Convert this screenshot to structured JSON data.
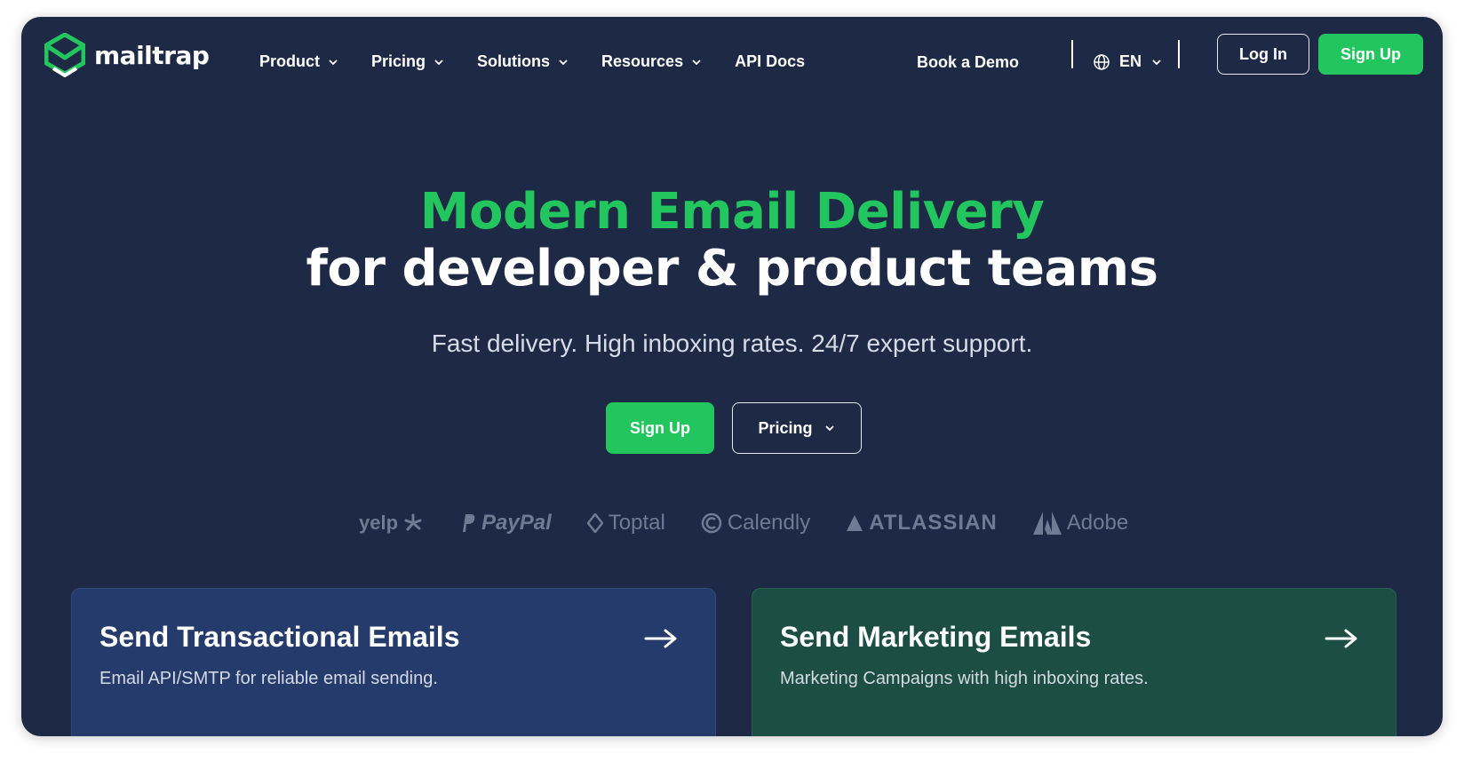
{
  "brand": {
    "name": "mailtrap",
    "accent": "#22c55e",
    "background": "#1e2a45"
  },
  "nav": {
    "items": [
      {
        "label": "Product",
        "has_dropdown": true
      },
      {
        "label": "Pricing",
        "has_dropdown": true
      },
      {
        "label": "Solutions",
        "has_dropdown": true
      },
      {
        "label": "Resources",
        "has_dropdown": true
      },
      {
        "label": "API Docs",
        "has_dropdown": false
      }
    ],
    "book_demo": "Book a Demo",
    "language": {
      "icon": "globe-icon",
      "value": "EN"
    },
    "login": "Log In",
    "signup": "Sign Up"
  },
  "hero": {
    "title_line1": "Modern Email Delivery",
    "title_line2": "for developer & product teams",
    "subtitle": "Fast delivery. High inboxing rates. 24/7 expert support.",
    "cta_primary": "Sign Up",
    "cta_secondary": "Pricing"
  },
  "customers": [
    "yelp",
    "PayPal",
    "Toptal",
    "Calendly",
    "ATLASSIAN",
    "Adobe"
  ],
  "cards": [
    {
      "title": "Send Transactional Emails",
      "description": "Email API/SMTP for reliable email sending.",
      "color": "#253b6b"
    },
    {
      "title": "Send Marketing Emails",
      "description": "Marketing Campaigns with high inboxing rates.",
      "color": "#1c4e43"
    }
  ]
}
